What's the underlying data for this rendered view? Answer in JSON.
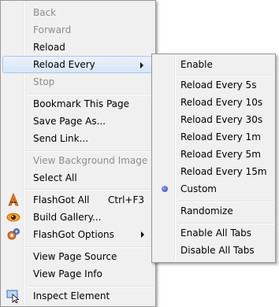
{
  "main_menu": {
    "back": "Back",
    "forward": "Forward",
    "reload": "Reload",
    "reload_every": "Reload Every",
    "stop": "Stop",
    "bookmark_page": "Bookmark This Page",
    "save_page": "Save Page As...",
    "send_link": "Send Link...",
    "view_bg_image": "View Background Image",
    "select_all": "Select All",
    "flashgot_all": "FlashGot All",
    "flashgot_all_shortcut": "Ctrl+F3",
    "build_gallery": "Build Gallery...",
    "flashgot_options": "FlashGot Options",
    "view_source": "View Page Source",
    "view_info": "View Page Info",
    "inspect": "Inspect Element"
  },
  "sub_menu": {
    "enable": "Enable",
    "every_5s": "Reload Every 5s",
    "every_10s": "Reload Every 10s",
    "every_30s": "Reload Every 30s",
    "every_1m": "Reload Every 1m",
    "every_5m": "Reload Every 5m",
    "every_15m": "Reload Every 15m",
    "custom": "Custom",
    "randomize": "Randomize",
    "enable_all_tabs": "Enable All Tabs",
    "disable_all_tabs": "Disable All Tabs",
    "selected_item": "Custom"
  },
  "colors": {
    "menu_bg": "#f0f0f0",
    "highlight_border": "#a8c8ee",
    "disabled_text": "#8d8d8d"
  }
}
